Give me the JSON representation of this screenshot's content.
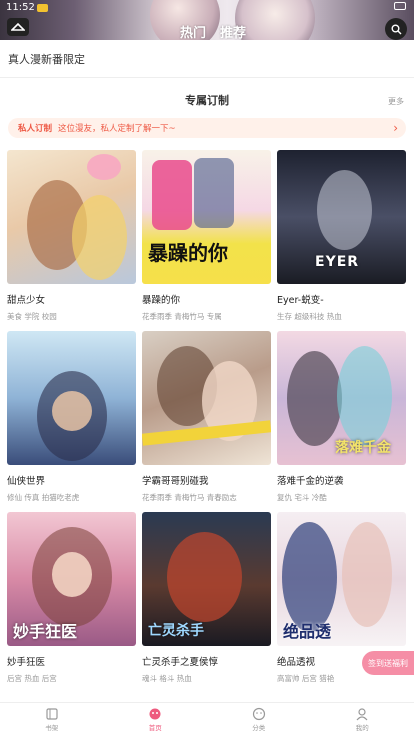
{
  "status": {
    "time": "11:52"
  },
  "header": {
    "tabs": [
      "热门",
      "推荐"
    ],
    "active_tab": 1
  },
  "subline": {
    "text": "真人漫新番限定"
  },
  "section": {
    "title": "专属订制",
    "more": "更多"
  },
  "banner": {
    "highlight": "私人订制",
    "text": "这位漫友，私人定制了解一下~"
  },
  "comics": [
    {
      "title": "甜点少女",
      "tags": "美食 学院 校园",
      "cover_text": ""
    },
    {
      "title": "暴躁的你",
      "tags": "花季雨季 青梅竹马 专属",
      "cover_text": "暴躁的你"
    },
    {
      "title": "Eyer-蜕变-",
      "tags": "生存 超级科技 热血",
      "cover_text": "EYER"
    },
    {
      "title": "仙侠世界",
      "tags": "修仙 传真 拍猫吃老虎",
      "cover_text": ""
    },
    {
      "title": "学霸哥哥别碰我",
      "tags": "花季雨季 青梅竹马 青春励志",
      "cover_text": ""
    },
    {
      "title": "落难千金的逆袭",
      "tags": "复仇 宅斗 冷酷",
      "cover_text": "落难千金"
    },
    {
      "title": "妙手狂医",
      "tags": "后宫 热血 后宫",
      "cover_text": "妙手狂医"
    },
    {
      "title": "亡灵杀手之夏侯惇",
      "tags": "魂斗 格斗 热血",
      "cover_text": "亡灵杀手"
    },
    {
      "title": "绝品透视",
      "tags": "高富帅 后宫 猎艳",
      "cover_text": "绝品透"
    }
  ],
  "floater": {
    "text": "签到送福利"
  },
  "tabbar": [
    {
      "label": "书架",
      "icon": "book-icon"
    },
    {
      "label": "首页",
      "icon": "home-icon"
    },
    {
      "label": "分类",
      "icon": "category-icon"
    },
    {
      "label": "我的",
      "icon": "profile-icon"
    }
  ],
  "colors": {
    "accent": "#ee5a7e",
    "banner_text": "#ee5a46",
    "floater": "#f58ea6"
  }
}
